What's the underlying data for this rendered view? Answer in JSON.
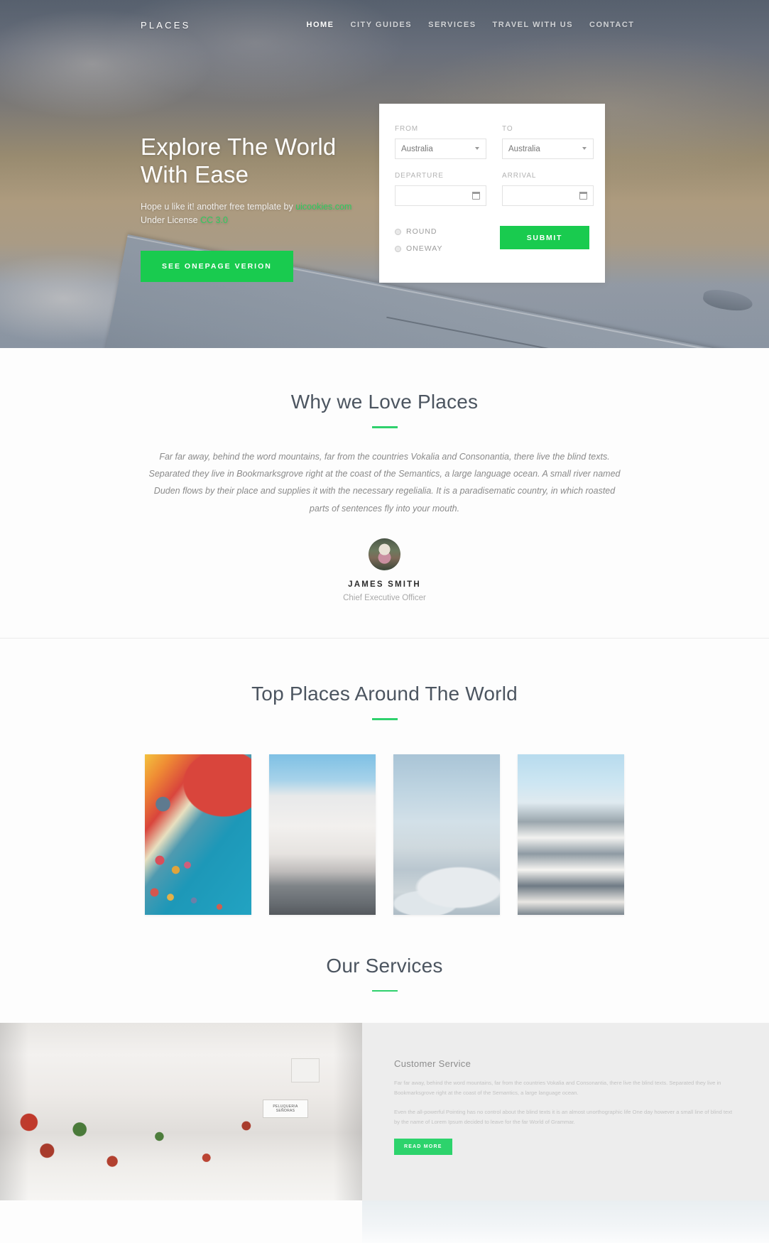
{
  "nav": {
    "brand": "PLACES",
    "links": [
      {
        "label": "HOME",
        "active": true
      },
      {
        "label": "CITY GUIDES",
        "active": false
      },
      {
        "label": "SERVICES",
        "active": false
      },
      {
        "label": "TRAVEL WITH US",
        "active": false
      },
      {
        "label": "CONTACT",
        "active": false
      }
    ]
  },
  "hero": {
    "title_line1": "Explore The World",
    "title_line2": "With Ease",
    "sub_prefix": "Hope u like it! another free template by ",
    "sub_link": "uicookies.com",
    "sub_license_prefix": "Under License ",
    "sub_license_link": "CC 3.0",
    "cta_label": "SEE ONEPAGE VERION"
  },
  "booking": {
    "from_label": "FROM",
    "from_value": "Australia",
    "to_label": "TO",
    "to_value": "Australia",
    "departure_label": "DEPARTURE",
    "departure_value": "",
    "arrival_label": "ARRIVAL",
    "arrival_value": "",
    "trip_options": [
      {
        "label": "ROUND"
      },
      {
        "label": "ONEWAY"
      }
    ],
    "submit_label": "SUBMIT"
  },
  "why": {
    "heading": "Why we Love Places",
    "body": "Far far away, behind the word mountains, far from the countries Vokalia and Consonantia, there live the blind texts. Separated they live in Bookmarksgrove right at the coast of the Semantics, a large language ocean. A small river named Duden flows by their place and supplies it with the necessary regelialia. It is a paradisematic country, in which roasted parts of sentences fly into your mouth.",
    "author_name": "JAMES SMITH",
    "author_role": "Chief Executive Officer"
  },
  "top_places": {
    "heading": "Top Places Around The World",
    "images": [
      {
        "alt": "hot-air-balloons"
      },
      {
        "alt": "spanish-white-village-street"
      },
      {
        "alt": "sydney-opera-house"
      },
      {
        "alt": "japanese-castle"
      }
    ]
  },
  "services": {
    "heading": "Our Services",
    "image_alt": "spanish-street-with-flower-pots",
    "card_title": "Customer Service",
    "paragraph1": "Far far away, behind the word mountains, far from the countries Vokalia and Consonantia, there live the blind texts. Separated they live in Bookmarksgrove right at the coast of the Semantics, a large language ocean.",
    "paragraph2": "Even the all-powerful Pointing has no control about the blind texts it is an almost unorthographic life One day however a small line of blind text by the name of Lorem Ipsum decided to leave for the far World of Grammar.",
    "read_more_label": "READ MORE",
    "image_sign": "PELUQUERIA SEÑORAS"
  },
  "colors": {
    "accent_green": "#19cb4f",
    "rule_green": "#2fd16d",
    "heading": "#4c5560"
  }
}
